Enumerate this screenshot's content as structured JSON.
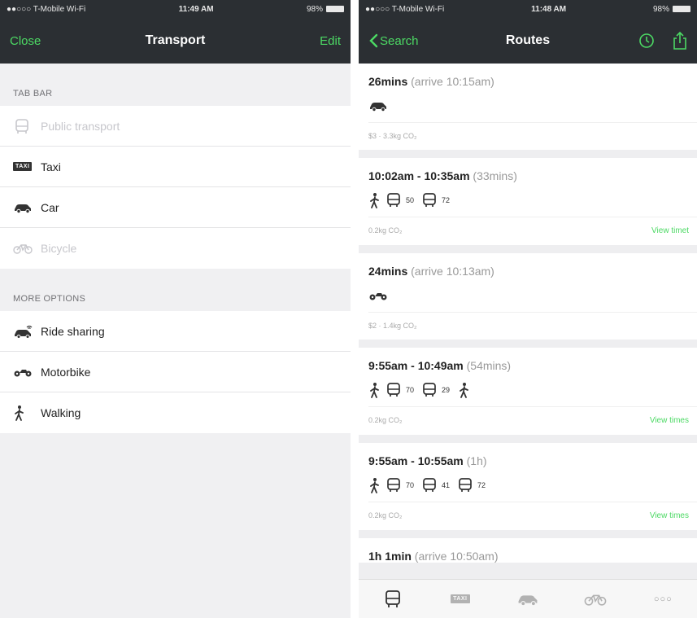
{
  "left": {
    "status": {
      "carrier": "●●○○○ T-Mobile Wi-Fi",
      "time": "11:49 AM",
      "battery": "98%"
    },
    "nav": {
      "close_label": "Close",
      "title": "Transport",
      "edit_label": "Edit"
    },
    "tab_bar_header": "TAB BAR",
    "tab_bar_items": [
      {
        "label": "Public transport",
        "enabled": false,
        "icon": "bus-icon"
      },
      {
        "label": "Taxi",
        "enabled": true,
        "icon": "taxi-icon",
        "badge": "TAXI"
      },
      {
        "label": "Car",
        "enabled": true,
        "icon": "car-icon"
      },
      {
        "label": "Bicycle",
        "enabled": false,
        "icon": "bicycle-icon"
      }
    ],
    "more_options_header": "MORE OPTIONS",
    "more_options_items": [
      {
        "label": "Ride sharing",
        "icon": "ride-sharing-icon"
      },
      {
        "label": "Motorbike",
        "icon": "motorbike-icon"
      },
      {
        "label": "Walking",
        "icon": "walking-icon"
      }
    ]
  },
  "right": {
    "status": {
      "carrier": "●●○○○ T-Mobile Wi-Fi",
      "time": "11:48 AM",
      "battery": "98%"
    },
    "nav": {
      "back_label": "Search",
      "title": "Routes"
    },
    "routes": [
      {
        "duration": "26mins",
        "extra": "(arrive 10:15am)",
        "footer": "$3 · 3.3kg CO₂",
        "view_times": "",
        "modes": [
          {
            "icon": "car-icon",
            "label": ""
          }
        ]
      },
      {
        "duration": "10:02am - 10:35am",
        "extra": "(33mins)",
        "footer": "0.2kg CO₂",
        "view_times": "View timet",
        "modes": [
          {
            "icon": "walking-icon",
            "label": ""
          },
          {
            "icon": "bus-icon",
            "label": "50"
          },
          {
            "icon": "bus-icon",
            "label": "72"
          }
        ]
      },
      {
        "duration": "24mins",
        "extra": "(arrive 10:13am)",
        "footer": "$2 · 1.4kg CO₂",
        "view_times": "",
        "modes": [
          {
            "icon": "motorbike-icon",
            "label": ""
          }
        ]
      },
      {
        "duration": "9:55am - 10:49am",
        "extra": "(54mins)",
        "footer": "0.2kg CO₂",
        "view_times": "View times",
        "modes": [
          {
            "icon": "walking-icon",
            "label": ""
          },
          {
            "icon": "bus-icon",
            "label": "70"
          },
          {
            "icon": "bus-icon",
            "label": "29"
          },
          {
            "icon": "walking-icon",
            "label": ""
          }
        ]
      },
      {
        "duration": "9:55am - 10:55am",
        "extra": "(1h)",
        "footer": "0.2kg CO₂",
        "view_times": "View times",
        "modes": [
          {
            "icon": "walking-icon",
            "label": ""
          },
          {
            "icon": "bus-icon",
            "label": "70"
          },
          {
            "icon": "bus-icon",
            "label": "41"
          },
          {
            "icon": "bus-icon",
            "label": "72"
          }
        ]
      },
      {
        "duration": "1h 1min",
        "extra": "(arrive 10:50am)",
        "footer": "",
        "view_times": "",
        "modes": []
      }
    ],
    "tabbar": {
      "taxi_badge": "TAXI",
      "more": "○○○"
    }
  },
  "colors": {
    "accent": "#4cd964",
    "navbar": "#2b2f33",
    "background": "#f0f0f2"
  }
}
